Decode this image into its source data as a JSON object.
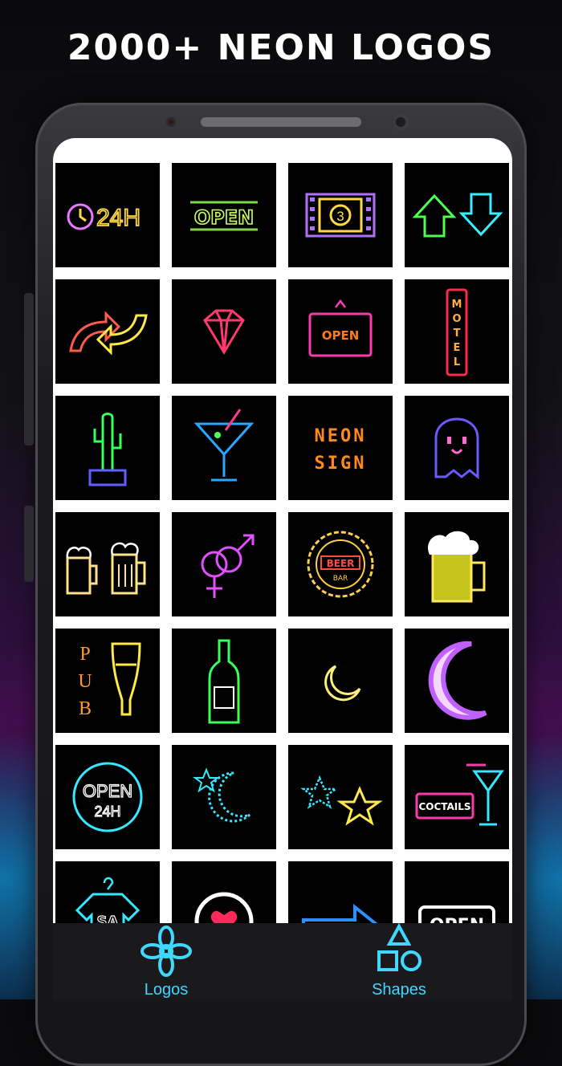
{
  "promo": {
    "headline": "2000+ NEON LOGOS"
  },
  "tiles": {
    "t1": {
      "text": "24H",
      "color": "#ffd84a",
      "icon": "clock-24h-icon"
    },
    "t2": {
      "text": "OPEN",
      "color": "#c8ff5a",
      "icon": "open-sign-icon"
    },
    "t3": {
      "icon": "film-countdown-icon"
    },
    "t4": {
      "icon": "up-down-arrows-icon"
    },
    "t5": {
      "icon": "curved-arrows-icon"
    },
    "t6": {
      "icon": "diamond-icon"
    },
    "t7": {
      "text": "OPEN",
      "color": "#ff7a1a",
      "icon": "hanging-open-sign-icon"
    },
    "t8": {
      "text": "MOTEL",
      "color": "#ffb040",
      "icon": "motel-sign-icon"
    },
    "t9": {
      "icon": "cactus-icon"
    },
    "t10": {
      "icon": "cocktail-glass-icon"
    },
    "t11": {
      "line1": "NEON",
      "line2": "SIGN",
      "color": "#ff8a1a"
    },
    "t12": {
      "icon": "ghost-icon"
    },
    "t13": {
      "icon": "beer-mugs-icon"
    },
    "t14": {
      "icon": "gender-symbols-icon"
    },
    "t15": {
      "line1": "BEER",
      "line2": "BAR",
      "icon": "beer-bar-badge-icon"
    },
    "t16": {
      "icon": "beer-mug-icon"
    },
    "t17": {
      "letters": [
        "P",
        "U",
        "B"
      ],
      "icon": "pub-glass-icon"
    },
    "t18": {
      "icon": "bottle-icon"
    },
    "t19": {
      "icon": "crescent-moon-small-icon"
    },
    "t20": {
      "icon": "crescent-moon-glow-icon"
    },
    "t21": {
      "line1": "OPEN",
      "line2": "24H",
      "icon": "open-24h-circle-icon"
    },
    "t22": {
      "icon": "moon-star-icon"
    },
    "t23": {
      "icon": "stars-icon"
    },
    "t24": {
      "text": "COCTAILS",
      "icon": "cocktails-sign-icon"
    },
    "t25": {
      "text": "SA",
      "icon": "shirt-hanger-icon"
    },
    "t26": {
      "icon": "heart-circle-icon"
    },
    "t27": {
      "icon": "right-arrow-icon"
    },
    "t28": {
      "text": "OPEN",
      "icon": "open-box-icon"
    }
  },
  "tabbar": {
    "logos_label": "Logos",
    "shapes_label": "Shapes",
    "accent": "#3fd8ff",
    "logos_icon": "flower-icon",
    "shapes_icon": "shapes-icon"
  }
}
